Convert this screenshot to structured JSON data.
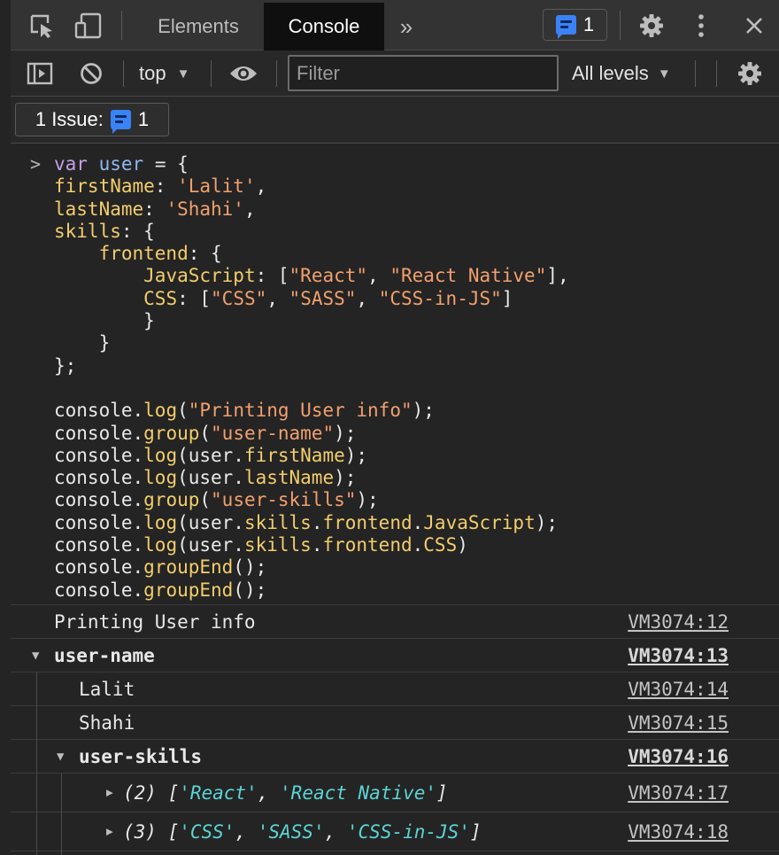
{
  "tabbar": {
    "tabs": [
      {
        "label": "Elements",
        "active": false
      },
      {
        "label": "Console",
        "active": true
      }
    ],
    "more_tabs_label": "»",
    "issues_count": "1",
    "icons": [
      "inspect-element-icon",
      "device-toolbar-icon",
      "settings-gear-icon",
      "more-menu-icon",
      "close-icon"
    ]
  },
  "toolbar": {
    "context_label": "top",
    "filter_placeholder": "Filter",
    "levels_label": "All levels",
    "icons": [
      "sidebar-toggle-icon",
      "clear-console-icon",
      "live-expression-eye-icon",
      "console-settings-gear-icon"
    ]
  },
  "issues_bar": {
    "label": "1 Issue:",
    "count": "1"
  },
  "console": {
    "prompt": ">",
    "code_lines": [
      [
        [
          "kw",
          "var"
        ],
        [
          "pl",
          " "
        ],
        [
          "vr",
          "user"
        ],
        [
          "pl",
          " = {"
        ]
      ],
      [
        [
          "pr",
          "firstName"
        ],
        [
          "pl",
          ": "
        ],
        [
          "st",
          "'Lalit'"
        ],
        [
          "pl",
          ","
        ]
      ],
      [
        [
          "pr",
          "lastName"
        ],
        [
          "pl",
          ": "
        ],
        [
          "st",
          "'Shahi'"
        ],
        [
          "pl",
          ","
        ]
      ],
      [
        [
          "pr",
          "skills"
        ],
        [
          "pl",
          ": {"
        ]
      ],
      [
        [
          "pl",
          "    "
        ],
        [
          "pr",
          "frontend"
        ],
        [
          "pl",
          ": {"
        ]
      ],
      [
        [
          "pl",
          "        "
        ],
        [
          "pr",
          "JavaScript"
        ],
        [
          "pl",
          ": ["
        ],
        [
          "st",
          "\"React\""
        ],
        [
          "pl",
          ", "
        ],
        [
          "st",
          "\"React Native\""
        ],
        [
          "pl",
          "],"
        ]
      ],
      [
        [
          "pl",
          "        "
        ],
        [
          "pr",
          "CSS"
        ],
        [
          "pl",
          ": ["
        ],
        [
          "st",
          "\"CSS\""
        ],
        [
          "pl",
          ", "
        ],
        [
          "st",
          "\"SASS\""
        ],
        [
          "pl",
          ", "
        ],
        [
          "st",
          "\"CSS-in-JS\""
        ],
        [
          "pl",
          "]"
        ]
      ],
      [
        [
          "pl",
          "        }"
        ]
      ],
      [
        [
          "pl",
          "    }"
        ]
      ],
      [
        [
          "pl",
          "};"
        ]
      ],
      [
        [
          "pl",
          ""
        ]
      ],
      [
        [
          "pl",
          "console."
        ],
        [
          "pr",
          "log"
        ],
        [
          "pl",
          "("
        ],
        [
          "st",
          "\"Printing User info\""
        ],
        [
          "pl",
          ");"
        ]
      ],
      [
        [
          "pl",
          "console."
        ],
        [
          "pr",
          "group"
        ],
        [
          "pl",
          "("
        ],
        [
          "st",
          "\"user-name\""
        ],
        [
          "pl",
          ");"
        ]
      ],
      [
        [
          "pl",
          "console."
        ],
        [
          "pr",
          "log"
        ],
        [
          "pl",
          "(user."
        ],
        [
          "pr",
          "firstName"
        ],
        [
          "pl",
          ");"
        ]
      ],
      [
        [
          "pl",
          "console."
        ],
        [
          "pr",
          "log"
        ],
        [
          "pl",
          "(user."
        ],
        [
          "pr",
          "lastName"
        ],
        [
          "pl",
          ");"
        ]
      ],
      [
        [
          "pl",
          "console."
        ],
        [
          "pr",
          "group"
        ],
        [
          "pl",
          "("
        ],
        [
          "st",
          "\"user-skills\""
        ],
        [
          "pl",
          ");"
        ]
      ],
      [
        [
          "pl",
          "console."
        ],
        [
          "pr",
          "log"
        ],
        [
          "pl",
          "(user."
        ],
        [
          "pr",
          "skills"
        ],
        [
          "pl",
          "."
        ],
        [
          "pr",
          "frontend"
        ],
        [
          "pl",
          "."
        ],
        [
          "pr",
          "JavaScript"
        ],
        [
          "pl",
          ");"
        ]
      ],
      [
        [
          "pl",
          "console."
        ],
        [
          "pr",
          "log"
        ],
        [
          "pl",
          "(user."
        ],
        [
          "pr",
          "skills"
        ],
        [
          "pl",
          "."
        ],
        [
          "pr",
          "frontend"
        ],
        [
          "pl",
          "."
        ],
        [
          "pr",
          "CSS"
        ],
        [
          "pl",
          ")"
        ]
      ],
      [
        [
          "pl",
          "console."
        ],
        [
          "pr",
          "groupEnd"
        ],
        [
          "pl",
          "();"
        ]
      ],
      [
        [
          "pl",
          "console."
        ],
        [
          "pr",
          "groupEnd"
        ],
        [
          "pl",
          "();"
        ]
      ]
    ],
    "outputs": {
      "printing_info": {
        "text": "Printing User info",
        "source": "VM3074:12"
      },
      "group_user_name": {
        "text": "user-name",
        "source": "VM3074:13"
      },
      "first_name": {
        "text": "Lalit",
        "source": "VM3074:14"
      },
      "last_name": {
        "text": "Shahi",
        "source": "VM3074:15"
      },
      "group_user_skills": {
        "text": "user-skills",
        "source": "VM3074:16"
      },
      "js_array": {
        "source": "VM3074:17",
        "parts": [
          [
            "p",
            "(2) ["
          ],
          [
            "s",
            "'React'"
          ],
          [
            "p",
            ", "
          ],
          [
            "s",
            "'React Native'"
          ],
          [
            "p",
            "]"
          ]
        ]
      },
      "css_array": {
        "source": "VM3074:18",
        "parts": [
          [
            "p",
            "(3) ["
          ],
          [
            "s",
            "'CSS'"
          ],
          [
            "p",
            ", "
          ],
          [
            "s",
            "'SASS'"
          ],
          [
            "p",
            ", "
          ],
          [
            "s",
            "'CSS-in-JS'"
          ],
          [
            "p",
            "]"
          ]
        ]
      }
    }
  }
}
